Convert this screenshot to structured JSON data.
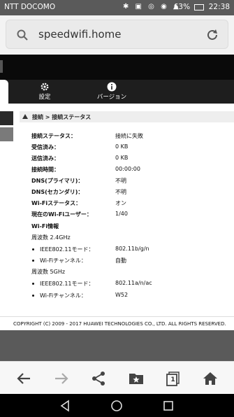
{
  "statusbar": {
    "carrier": "NTT DOCOMO",
    "battery": "63%",
    "time": "22:38"
  },
  "browser": {
    "url": "speedwifi.home"
  },
  "nav": {
    "settings_label": "設定",
    "version_label": "バージョン"
  },
  "breadcrumb": "接続 > 接続ステータス",
  "status_rows": [
    {
      "label": "接続ステータス：",
      "value": "接続に失敗"
    },
    {
      "label": "受信済み：",
      "value": "0 KB"
    },
    {
      "label": "送信済み：",
      "value": "0 KB"
    },
    {
      "label": "接続時間：",
      "value": "00:00:00"
    },
    {
      "label": "DNS(プライマリ)：",
      "value": "不明"
    },
    {
      "label": "DNS(セカンダリ)：",
      "value": "不明"
    },
    {
      "label": "Wi-Fiステータス：",
      "value": "オン"
    },
    {
      "label": "現在のWi-Fiユーザー：",
      "value": "1/40"
    }
  ],
  "wifi": {
    "heading": "Wi-Fi情報",
    "band_24_label": "周波数 2.4GHz",
    "band_24": [
      {
        "label": "IEEE802.11モード：",
        "value": "802.11b/g/n"
      },
      {
        "label": "Wi-Fiチャンネル：",
        "value": "自動"
      }
    ],
    "band_5_label": "周波数 5GHz",
    "band_5": [
      {
        "label": "IEEE802.11モード：",
        "value": "802.11a/n/ac"
      },
      {
        "label": "Wi-Fiチャンネル：",
        "value": "W52"
      }
    ]
  },
  "copyright": "COPYRIGHT (C) 2009 - 2017 HUAWEI TECHNOLOGIES CO., LTD. ALL RIGHTS RESERVED.",
  "toolbar": {
    "tabs_count": "1"
  }
}
